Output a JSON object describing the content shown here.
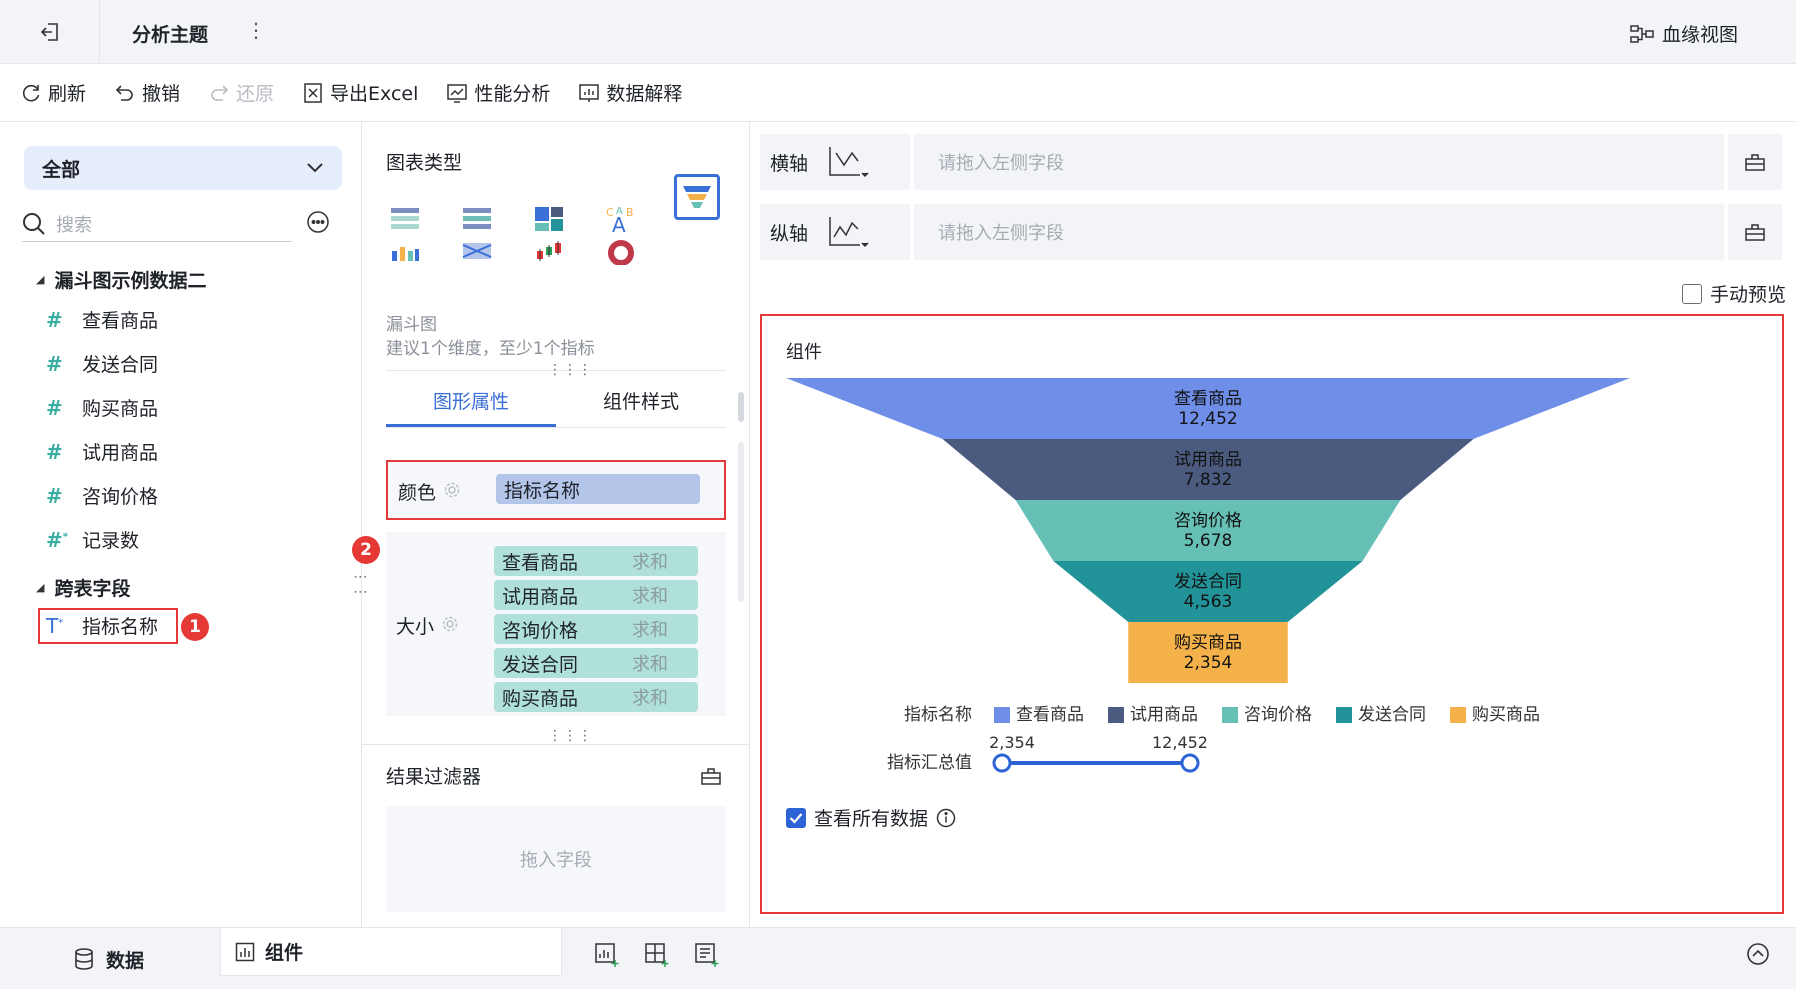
{
  "header": {
    "title": "分析主题",
    "more": "⋮",
    "lineage_label": "血缘视图"
  },
  "toolbar": {
    "refresh": "刷新",
    "undo": "撤销",
    "redo": "还原",
    "export_excel": "导出Excel",
    "perf_analysis": "性能分析",
    "data_explain": "数据解释"
  },
  "left": {
    "scope": "全部",
    "search_placeholder": "搜索",
    "group1_title": "漏斗图示例数据二",
    "group1_fields": [
      "查看商品",
      "发送合同",
      "购买商品",
      "试用商品",
      "咨询价格",
      "记录数"
    ],
    "group2_title": "跨表字段",
    "group2_field": "指标名称",
    "marker1": "1"
  },
  "mid": {
    "chart_type_title": "图表类型",
    "chart_type_name": "漏斗图",
    "chart_type_hint": "建议1个维度，至少1个指标",
    "tab_graph": "图形属性",
    "tab_style": "组件样式",
    "color_label": "颜色",
    "color_field": "指标名称",
    "marker2": "2",
    "size_label": "大小",
    "size_fields": [
      {
        "name": "查看商品",
        "agg": "求和"
      },
      {
        "name": "试用商品",
        "agg": "求和"
      },
      {
        "name": "咨询价格",
        "agg": "求和"
      },
      {
        "name": "发送合同",
        "agg": "求和"
      },
      {
        "name": "购买商品",
        "agg": "求和"
      }
    ],
    "filter_title": "结果过滤器",
    "filter_placeholder": "拖入字段"
  },
  "right": {
    "x_axis_label": "横轴",
    "y_axis_label": "纵轴",
    "axis_placeholder": "请拖入左侧字段",
    "manual_preview": "手动预览",
    "component_title": "组件",
    "legend_title": "指标名称",
    "range_title": "指标汇总值",
    "range_min": "2,354",
    "range_max": "12,452",
    "view_all": "查看所有数据"
  },
  "chart_data": {
    "type": "funnel",
    "categories": [
      "查看商品",
      "试用商品",
      "咨询价格",
      "发送合同",
      "购买商品"
    ],
    "values": [
      12452,
      7832,
      5678,
      4563,
      2354
    ],
    "value_labels": [
      "12,452",
      "7,832",
      "5,678",
      "4,563",
      "2,354"
    ],
    "colors": [
      "#6f8ee8",
      "#4b5b80",
      "#66c0b6",
      "#23939a",
      "#f6b24a"
    ],
    "legend_placement": "bottom"
  },
  "bottom": {
    "tab_data": "数据",
    "tab_component": "组件"
  }
}
